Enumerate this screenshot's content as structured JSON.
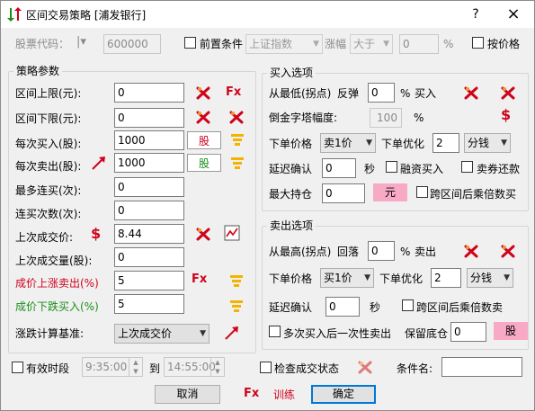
{
  "window": {
    "title": "区间交易策略 [浦发银行]",
    "help": "?",
    "close": "×"
  },
  "top": {
    "stock_code_label": "股票代码：",
    "stock_code_value": "600000",
    "precondition_label": "前置条件",
    "index_select": "上证指数",
    "change_label": "涨幅",
    "compare_select": "大于",
    "change_value": "0",
    "percent": "%",
    "by_price_label": "按价格"
  },
  "strategy": {
    "group_title": "策略参数",
    "rows": [
      {
        "label": "区间上限(元):",
        "value": "0"
      },
      {
        "label": "区间下限(元):",
        "value": "0"
      },
      {
        "label": "每次买入(股):",
        "value": "1000",
        "unit": "股"
      },
      {
        "label": "每次卖出(股):",
        "value": "1000",
        "unit": "股"
      },
      {
        "label": "最多连买(次):",
        "value": "0"
      },
      {
        "label": "连买次数(次):",
        "value": "0"
      },
      {
        "label": "上次成交价:",
        "value": "8.44"
      },
      {
        "label": "上次成交量(股):",
        "value": "0"
      },
      {
        "label": "成价上涨卖出(%)",
        "value": "5"
      },
      {
        "label": "成价下跌买入(%)",
        "value": "5"
      }
    ],
    "base_label": "涨跌计算基准:",
    "base_select": "上次成交价",
    "fx": "Fx",
    "dollar": "$"
  },
  "buy": {
    "group_title": "买入选项",
    "from_low_label": "从最低(拐点)",
    "rebound_label": "反弹",
    "rebound_value": "0",
    "percent": "%",
    "buy_label": "买入",
    "pyramid_label": "倒金字塔幅度:",
    "pyramid_value": "100",
    "price_label": "下单价格",
    "price_select": "卖1价",
    "optimize_label": "下单优化",
    "optimize_value": "2",
    "unit_select": "分钱",
    "delay_label": "延迟确认",
    "delay_value": "0",
    "seconds": "秒",
    "margin_buy_label": "融资买入",
    "short_cover_label": "卖券还款",
    "max_hold_label": "最大持仓",
    "max_hold_value": "0",
    "max_hold_unit": "元",
    "cross_label": "跨区间后乘倍数买"
  },
  "sell": {
    "group_title": "卖出选项",
    "from_high_label": "从最高(拐点)",
    "fall_label": "回落",
    "fall_value": "0",
    "percent": "%",
    "sell_label": "卖出",
    "price_label": "下单价格",
    "price_select": "买1价",
    "optimize_label": "下单优化",
    "optimize_value": "2",
    "unit_select": "分钱",
    "delay_label": "延迟确认",
    "delay_value": "0",
    "seconds": "秒",
    "cross_label": "跨区间后乘倍数卖",
    "multi_buy_label": "多次买入后一次性卖出",
    "keep_base_label": "保留底仓",
    "keep_base_value": "0",
    "keep_base_unit": "股"
  },
  "bottom": {
    "valid_period_label": "有效时段",
    "start_time": "9:35:00",
    "to_label": "到",
    "end_time": "14:55:00",
    "check_status_label": "检查成交状态",
    "condition_name_label": "条件名:",
    "condition_name_value": "",
    "cancel": "取消",
    "fx": "Fx",
    "train": "训练",
    "ok": "确定"
  },
  "colors": {
    "red": "#d0021b",
    "green": "#1a8f1a",
    "pink": "#f8a9c6",
    "gold": "#f3b300",
    "accent": "#0078d7"
  }
}
